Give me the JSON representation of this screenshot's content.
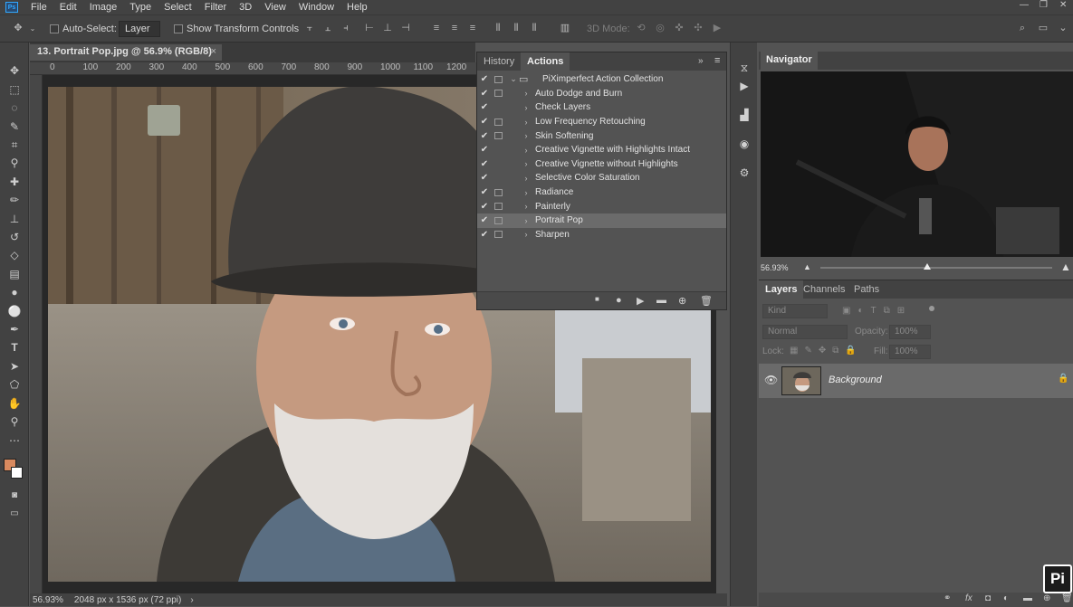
{
  "menu": [
    "File",
    "Edit",
    "Image",
    "Type",
    "Select",
    "Filter",
    "3D",
    "View",
    "Window",
    "Help"
  ],
  "app_logo": "Ps",
  "options": {
    "auto_select_label": "Auto-Select:",
    "auto_select_value": "Layer",
    "show_transform_label": "Show Transform Controls",
    "mode_3d_label": "3D Mode:"
  },
  "document": {
    "tab_title": "13. Portrait Pop.jpg @ 56.9% (RGB/8)",
    "close": "×",
    "ruler_ticks": [
      "0",
      "100",
      "200",
      "300",
      "400",
      "500",
      "600",
      "700",
      "800",
      "900",
      "1000",
      "1100",
      "1200"
    ],
    "status_zoom": "56.93%",
    "status_info": "2048 px x 1536 px (72 ppi)"
  },
  "actions_panel": {
    "tabs": [
      "History",
      "Actions"
    ],
    "active_tab": "Actions",
    "items": [
      {
        "label": "PiXimperfect Action Collection",
        "dialog": true,
        "folder": true
      },
      {
        "label": "Auto Dodge and Burn",
        "dialog": true
      },
      {
        "label": "Check Layers",
        "dialog": false
      },
      {
        "label": "Low Frequency Retouching",
        "dialog": true
      },
      {
        "label": "Skin Softening",
        "dialog": true
      },
      {
        "label": "Creative Vignette with Highlights Intact",
        "dialog": false
      },
      {
        "label": "Creative Vignette without Highlights",
        "dialog": false
      },
      {
        "label": "Selective Color Saturation",
        "dialog": false
      },
      {
        "label": "Radiance",
        "dialog": true
      },
      {
        "label": "Painterly",
        "dialog": true
      },
      {
        "label": "Portrait Pop",
        "dialog": true,
        "selected": true
      },
      {
        "label": "Sharpen",
        "dialog": true
      }
    ]
  },
  "navigator": {
    "title": "Navigator",
    "zoom": "56.93%",
    "zoom_slider_fraction": 0.46
  },
  "layers_panel": {
    "tabs": [
      "Layers",
      "Channels",
      "Paths"
    ],
    "filter_placeholder": "Kind",
    "blend_mode": "Normal",
    "opacity_label": "Opacity:",
    "opacity_value": "100%",
    "lock_label": "Lock:",
    "fill_label": "Fill:",
    "fill_value": "100%",
    "layer_name": "Background"
  },
  "badge": "Pi",
  "colors": {
    "foreground": "#d98a5f",
    "background": "#ffffff",
    "accent": "#31a8ff"
  }
}
